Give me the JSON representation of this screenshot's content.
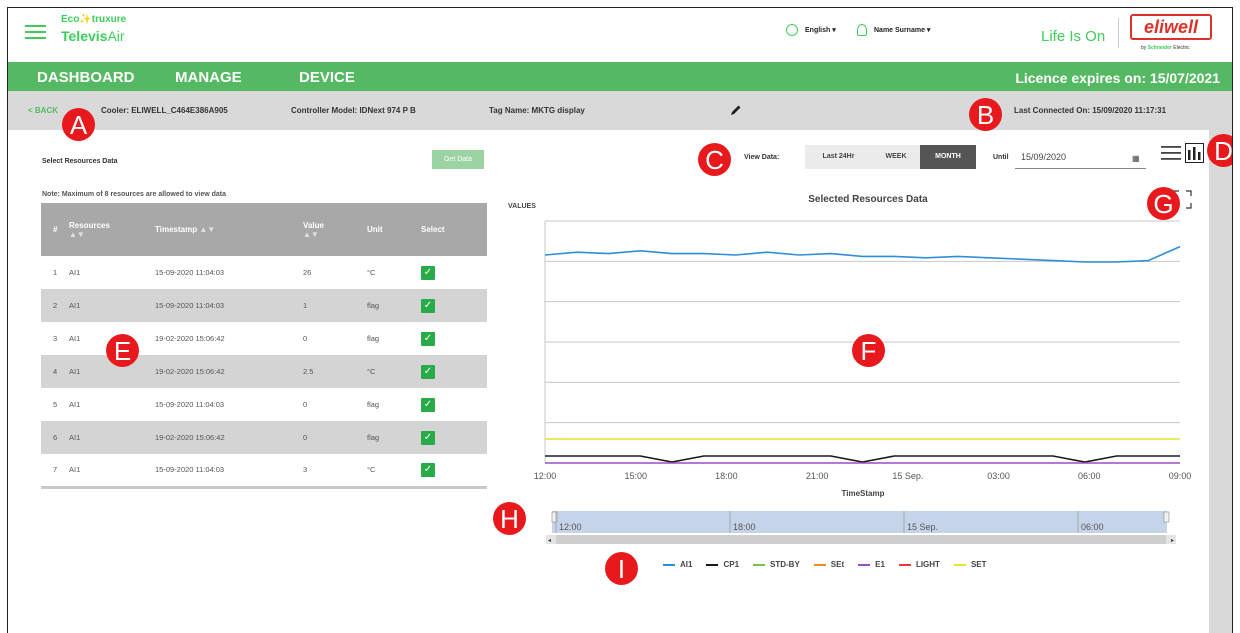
{
  "header": {
    "brand_top": "Eco✨truxure",
    "brand_bold": "Televis",
    "brand_light": "Air",
    "language": "English",
    "user_name": "Name Surname",
    "tagline": "Life Is On",
    "logo_text": "eliwell",
    "logo_by": "by",
    "logo_company": "Schneider",
    "logo_company_suffix": "Electric"
  },
  "nav": {
    "items": [
      "DASHBOARD",
      "MANAGE",
      "DEVICE"
    ],
    "licence": "Licence expires on: 15/07/2021"
  },
  "info": {
    "back": "< BACK",
    "cooler": "Cooler: ELIWELL_C464E386A905",
    "controller": "Controller Model: IDNext 974 P B",
    "tag": "Tag Name: MKTG display",
    "last_connected": "Last Connected On: 15/09/2020  11:17:31"
  },
  "resources": {
    "title": "Select Resources Data",
    "get_data": "Get Data",
    "note": "Note: Maximum of 8 resources are allowed to view data",
    "columns": [
      "#",
      "Resources",
      "Timestamp",
      "Value",
      "Unit",
      "Select"
    ],
    "rows": [
      {
        "n": "1",
        "res": "AI1",
        "ts": "15-09-2020  11:04:03",
        "val": "26",
        "unit": "°C"
      },
      {
        "n": "2",
        "res": "AI1",
        "ts": "15-09-2020  11:04:03",
        "val": "1",
        "unit": "flag"
      },
      {
        "n": "3",
        "res": "AI1",
        "ts": "19-02-2020  15:06:42",
        "val": "0",
        "unit": "flag"
      },
      {
        "n": "4",
        "res": "AI1",
        "ts": "19-02-2020  15:06:42",
        "val": "2.5",
        "unit": "°C"
      },
      {
        "n": "5",
        "res": "AI1",
        "ts": "15-09-2020  11:04:03",
        "val": "0",
        "unit": "flag"
      },
      {
        "n": "6",
        "res": "AI1",
        "ts": "19-02-2020  15:06:42",
        "val": "0",
        "unit": "flag"
      },
      {
        "n": "7",
        "res": "AI1",
        "ts": "15-09-2020  11:04:03",
        "val": "3",
        "unit": "°C"
      }
    ]
  },
  "view": {
    "label": "View Data:",
    "options": [
      "Last 24Hr",
      "WEEK",
      "MONTH"
    ],
    "selected": "MONTH",
    "until_label": "Until",
    "until_value": "15/09/2020"
  },
  "markers": [
    "A",
    "B",
    "C",
    "D",
    "E",
    "F",
    "G",
    "H",
    "I"
  ],
  "chart_data": {
    "type": "line",
    "title": "Selected Resources Data",
    "ylabel": "VALUES",
    "xlabel": "TimeStamp",
    "x_ticks": [
      "12:00",
      "15:00",
      "18:00",
      "21:00",
      "15 Sep.",
      "03:00",
      "06:00",
      "09:00"
    ],
    "navigator_ticks": [
      "12:00",
      "18:00",
      "15 Sep.",
      "06:00"
    ],
    "grid": true,
    "legend_position": "bottom",
    "series": [
      {
        "name": "AI1",
        "color": "#2d8fd5",
        "values": [
          26.0,
          26.2,
          26.1,
          26.3,
          26.1,
          26.1,
          26.0,
          26.2,
          26.0,
          26.1,
          25.9,
          25.9,
          25.8,
          25.9,
          25.8,
          25.7,
          25.6,
          25.5,
          25.5,
          25.6,
          26.6
        ]
      },
      {
        "name": "CP1",
        "color": "#1a1a1a",
        "values": [
          1,
          1,
          1,
          1,
          0,
          1,
          1,
          1,
          1,
          1,
          0,
          1,
          1,
          1,
          1,
          1,
          1,
          0,
          1,
          1,
          1
        ]
      },
      {
        "name": "STD-BY",
        "color": "#7cc242",
        "values": []
      },
      {
        "name": "SEt",
        "color": "#f08a24",
        "values": []
      },
      {
        "name": "E1",
        "color": "#9b4fc4",
        "values": [
          0,
          0,
          0,
          0,
          0,
          0,
          0,
          0,
          0,
          0,
          0,
          0,
          0,
          0,
          0,
          0,
          0,
          0,
          0,
          0,
          0
        ]
      },
      {
        "name": "LIGHT",
        "color": "#e53935",
        "values": []
      },
      {
        "name": "SET",
        "color": "#e6e030",
        "values": [
          3,
          3,
          3,
          3,
          3,
          3,
          3,
          3,
          3,
          3,
          3,
          3,
          3,
          3,
          3,
          3,
          3,
          3,
          3,
          3,
          3
        ]
      }
    ]
  }
}
